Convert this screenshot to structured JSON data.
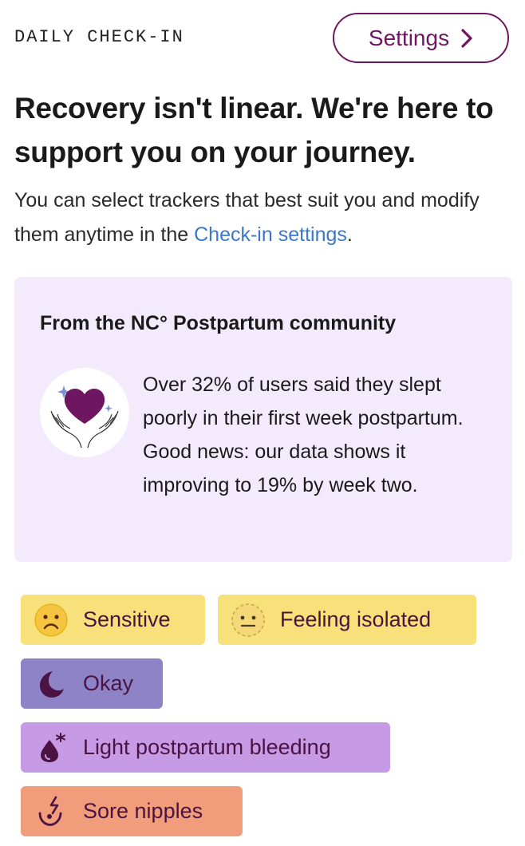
{
  "header": {
    "eyebrow": "DAILY CHECK-IN",
    "settings_label": "Settings",
    "settings_icon": "chevron-right-icon"
  },
  "intro": {
    "headline": "Recovery isn't linear. We're here to support you on your journey.",
    "body_before_link": "You can select trackers that best suit you and modify them anytime in the ",
    "link_label": "Check-in settings",
    "body_after_link": "."
  },
  "community_card": {
    "title": "From the NC° Postpartum community",
    "illustration": "heart-hands-icon",
    "text": "Over 32% of users said they slept poorly in their first week postpartum. Good news: our data shows it improving to 19% by week two."
  },
  "trackers": [
    {
      "label": "Sensitive",
      "icon": "sad-face-icon",
      "color": "#f8e07a"
    },
    {
      "label": "Feeling isolated",
      "icon": "neutral-face-dashed-icon",
      "color": "#f8e07a"
    },
    {
      "label": "Okay",
      "icon": "moon-icon",
      "color": "#8f83c8"
    },
    {
      "label": "Light postpartum bleeding",
      "icon": "drop-icon",
      "color": "#c79ae6"
    },
    {
      "label": "Sore nipples",
      "icon": "breast-pain-icon",
      "color": "#f19d7b"
    }
  ],
  "colors": {
    "accent": "#6e1760",
    "link": "#3b78c9",
    "card_bg": "#f3ebfb"
  }
}
